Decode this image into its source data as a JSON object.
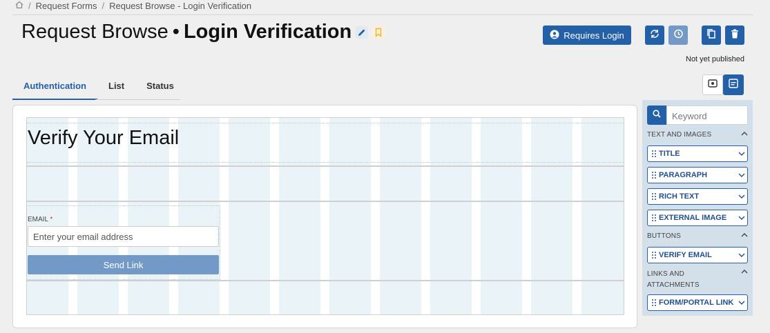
{
  "breadcrumb": {
    "items": [
      "Request Forms",
      "Request Browse - Login Verification"
    ]
  },
  "header": {
    "title_prefix": "Request Browse",
    "title_bullet": "•",
    "title_main": "Login Verification",
    "login_button": "Requires Login",
    "status": "Not yet published"
  },
  "tabs": [
    "Authentication",
    "List",
    "Status"
  ],
  "canvas": {
    "heading": "Verify Your Email",
    "email_label": "EMAIL",
    "required_mark": "*",
    "email_placeholder": "Enter your email address",
    "send_button": "Send Link"
  },
  "sidebar": {
    "search_placeholder": "Keyword",
    "sections": {
      "text_images": "TEXT AND IMAGES",
      "buttons": "BUTTONS",
      "links": "LINKS AND ATTACHMENTS"
    },
    "components": {
      "title": "TITLE",
      "paragraph": "PARAGRAPH",
      "rich_text": "RICH TEXT",
      "external_image": "EXTERNAL IMAGE",
      "verify_email": "VERIFY EMAIL",
      "form_portal_link": "FORM/PORTAL LINK"
    }
  },
  "colors": {
    "accent": "#2460a7",
    "accent_muted": "#7399c6",
    "bookmark": "#e8b33a"
  }
}
